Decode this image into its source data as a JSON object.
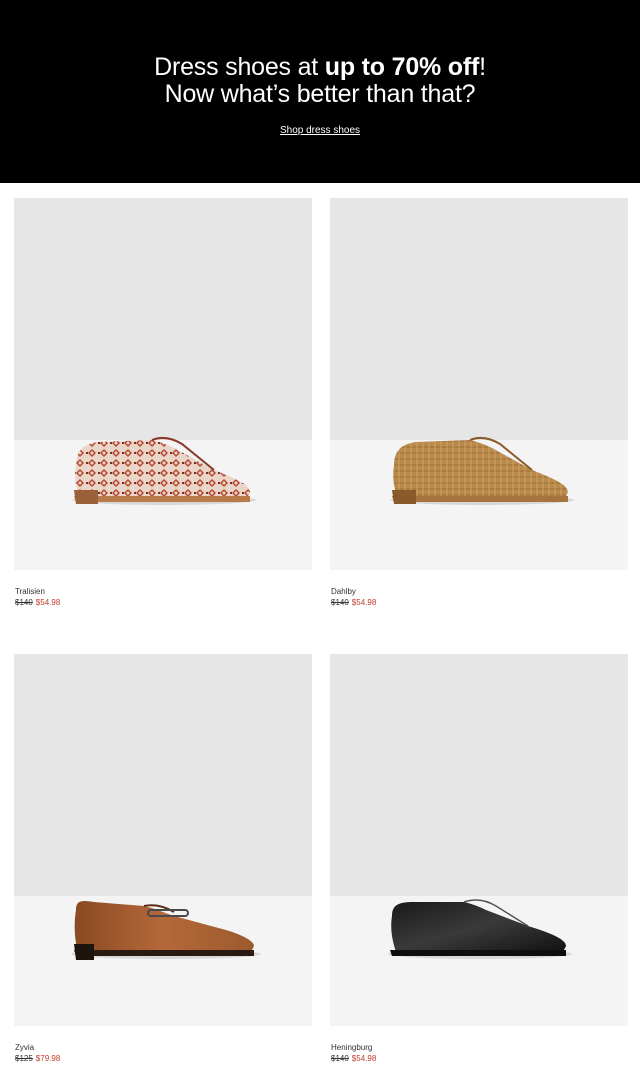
{
  "banner": {
    "line1_prefix": "Dress shoes at ",
    "line1_bold": "up to 70% off",
    "line1_suffix": "!",
    "line2": "Now what’s better than that?",
    "cta": "Shop dress shoes"
  },
  "products": [
    {
      "name": "Tralisien",
      "original_price": "$140",
      "sale_price": "$54.98",
      "image_icon": "patterned-loafer-icon"
    },
    {
      "name": "Dahlby",
      "original_price": "$140",
      "sale_price": "$54.98",
      "image_icon": "woven-loafer-icon"
    },
    {
      "name": "Zyvia",
      "original_price": "$125",
      "sale_price": "$79.98",
      "image_icon": "bit-loafer-icon"
    },
    {
      "name": "Heningburg",
      "original_price": "$140",
      "sale_price": "$54.98",
      "image_icon": "velvet-loafer-icon"
    }
  ],
  "colors": {
    "banner_bg": "#000000",
    "sale_price": "#c0392b"
  }
}
